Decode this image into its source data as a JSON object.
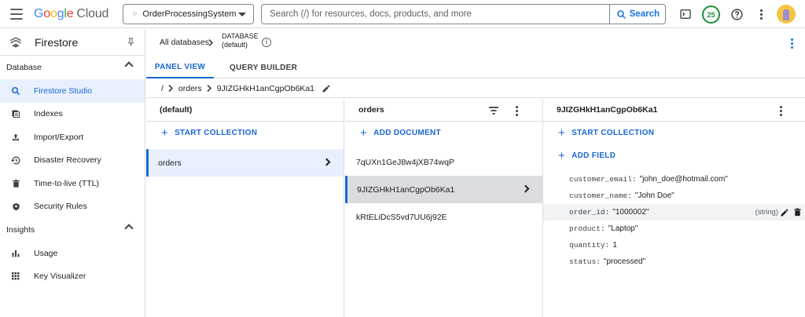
{
  "topbar": {
    "product": "Cloud",
    "project": "OrderProcessingSystem",
    "search_placeholder": "Search (/) for resources, docs, products, and more",
    "search_button": "Search",
    "notification_count": "25"
  },
  "sidebar": {
    "title": "Firestore",
    "sections": [
      {
        "label": "Database",
        "items": [
          {
            "label": "Firestore Studio",
            "icon": "search-icon"
          },
          {
            "label": "Indexes",
            "icon": "indexes-icon"
          },
          {
            "label": "Import/Export",
            "icon": "upload-icon"
          },
          {
            "label": "Disaster Recovery",
            "icon": "history-icon"
          },
          {
            "label": "Time-to-live (TTL)",
            "icon": "trash-icon"
          },
          {
            "label": "Security Rules",
            "icon": "shield-icon"
          }
        ]
      },
      {
        "label": "Insights",
        "items": [
          {
            "label": "Usage",
            "icon": "bar-chart-icon"
          },
          {
            "label": "Key Visualizer",
            "icon": "grid-icon"
          }
        ]
      }
    ]
  },
  "header": {
    "all_databases": "All databases",
    "database_label": "DATABASE",
    "database_name": "(default)"
  },
  "tabs": [
    "PANEL VIEW",
    "QUERY BUILDER"
  ],
  "path": {
    "root": "/",
    "collection": "orders",
    "document": "9JIZGHkH1anCgpOb6Ka1"
  },
  "panels": {
    "root": {
      "title": "(default)",
      "action": "START COLLECTION",
      "collections": [
        "orders"
      ]
    },
    "collection": {
      "title": "orders",
      "action": "ADD DOCUMENT",
      "documents": [
        "7qUXn1GeJ8w4jXB74wqP",
        "9JIZGHkH1anCgpOb6Ka1",
        "kRtELiDcS5vd7UU6j92E"
      ]
    },
    "document": {
      "title": "9JIZGHkH1anCgpOb6Ka1",
      "action_collection": "START COLLECTION",
      "action_field": "ADD FIELD",
      "fields": [
        {
          "key": "customer_email:",
          "value": "\"john_doe@hotmail.com\""
        },
        {
          "key": "customer_name:",
          "value": "\"John Doe\""
        },
        {
          "key": "order_id:",
          "value": "\"1000002\"",
          "type": "(string)"
        },
        {
          "key": "product:",
          "value": "\"Laptop\""
        },
        {
          "key": "quantity:",
          "value": "1"
        },
        {
          "key": "status:",
          "value": "\"processed\""
        }
      ]
    }
  },
  "colors": {
    "accent": "#1a73e8",
    "selected_bg": "#e8f0fe",
    "badge_green": "#1e8e3e"
  }
}
